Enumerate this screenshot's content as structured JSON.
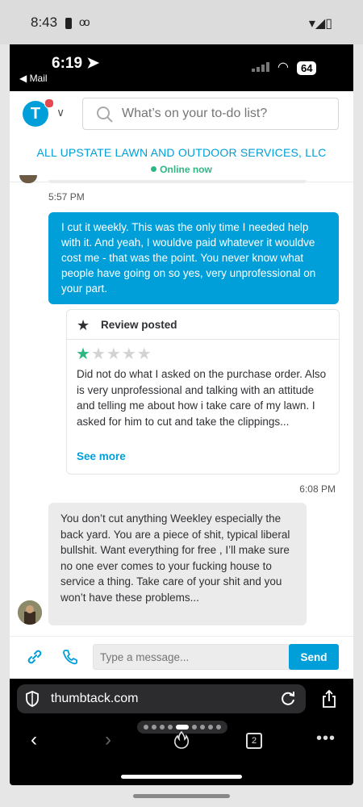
{
  "android_status": {
    "time": "8:43"
  },
  "ios_status": {
    "time": "6:19",
    "back_label": "◀ Mail",
    "battery": "64"
  },
  "header": {
    "search_placeholder": "What’s on your to-do list?",
    "logo_letter": "T"
  },
  "business": {
    "name": "ALL UPSTATE LAWN AND OUTDOOR SERVICES, LLC",
    "status": "Online now"
  },
  "messages": [
    {
      "time": "5:57 PM",
      "text": "I cut it weekly. This was the only time I needed help with it. And yeah, I wouldve paid whatever it wouldve cost me - that was the point. You never know what people have going on so yes, very unprofessional on your part."
    },
    {
      "time": "6:08 PM",
      "text": "You don’t cut anything Weekley especially the back yard. You are a piece of shit, typical liberal bullshit. Want everything for free , I’ll make sure no one ever comes to your fucking house to service a thing. Take care of your shit and you won’t have these problems..."
    }
  ],
  "review": {
    "title": "Review posted",
    "rating": 1,
    "max_rating": 5,
    "text": "Did not do what I asked on the purchase order. Also is very unprofessional and talking with an attitude and telling me about how i take care of my lawn. I asked for him to cut and take the clippings...",
    "see_more": "See more"
  },
  "composer": {
    "placeholder": "Type a message...",
    "send_label": "Send"
  },
  "browser": {
    "url": "thumbtack.com",
    "tab_count": "2"
  },
  "colors": {
    "brand": "#009fd9",
    "online": "#2db783",
    "star": "#2db783"
  }
}
